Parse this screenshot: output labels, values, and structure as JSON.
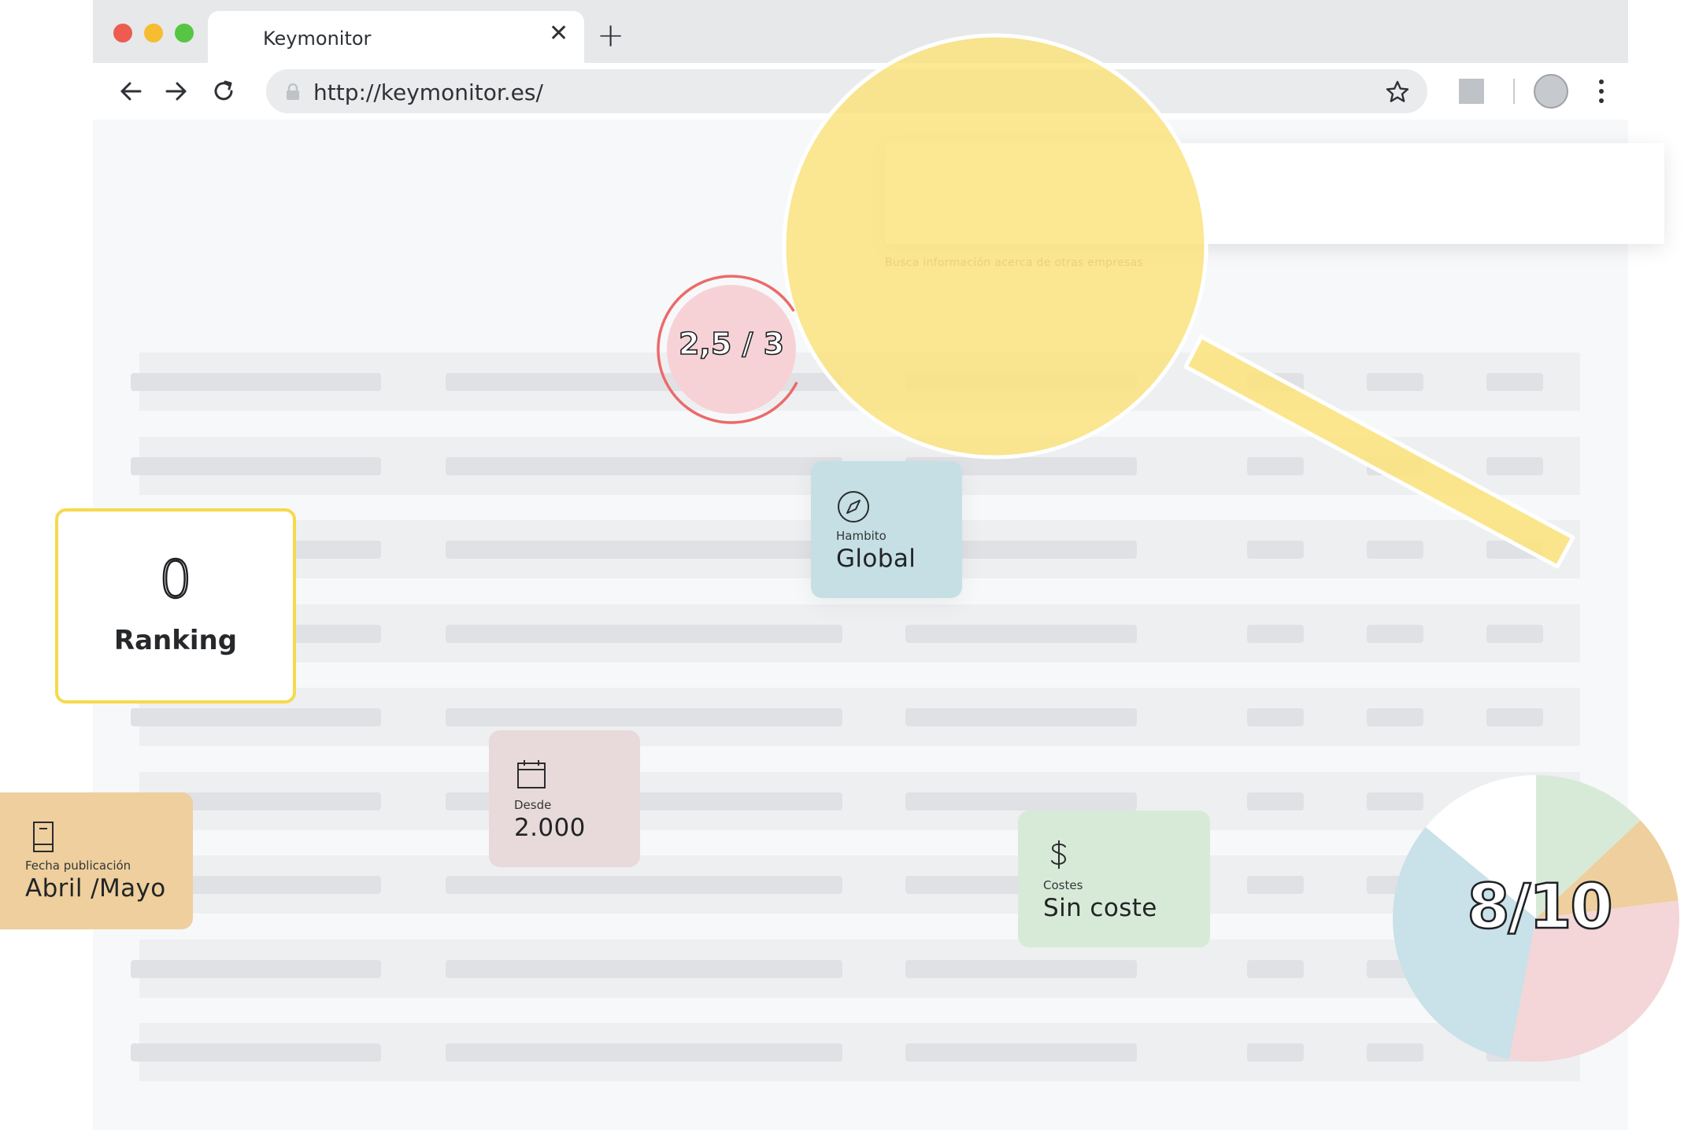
{
  "browser": {
    "tab_title": "Keymonitor",
    "url": "http://keymonitor.es/"
  },
  "search": {
    "hint": "Busca información acerca de otras empresas"
  },
  "rating": {
    "text": "2,5 / 3",
    "value": 2.5,
    "max": 3
  },
  "ranking": {
    "value": "0",
    "label": "Ranking"
  },
  "cards": {
    "global": {
      "label": "Hambito",
      "value": "Global",
      "icon": "compass-icon"
    },
    "desde": {
      "label": "Desde",
      "value": "2.000",
      "icon": "calendar-icon"
    },
    "costes": {
      "label": "Costes",
      "value": "Sin coste",
      "icon": "dollar-icon"
    },
    "fecha": {
      "label": "Fecha publicación",
      "value": "Abril /Mayo",
      "icon": "book-icon"
    }
  },
  "score": {
    "text": "8/10",
    "value": 8,
    "max": 10
  },
  "chart_data": {
    "type": "pie",
    "values": [
      13,
      10,
      30,
      33,
      14
    ],
    "colors": [
      "#d7ead8",
      "#eecf9d",
      "#f4d5d8",
      "#c9e1e8",
      "#ffffff"
    ]
  },
  "colors": {
    "accent_yellow": "#f7d94c",
    "rating_red": "#ec6a6a",
    "rating_fill": "#f6d2d6"
  }
}
